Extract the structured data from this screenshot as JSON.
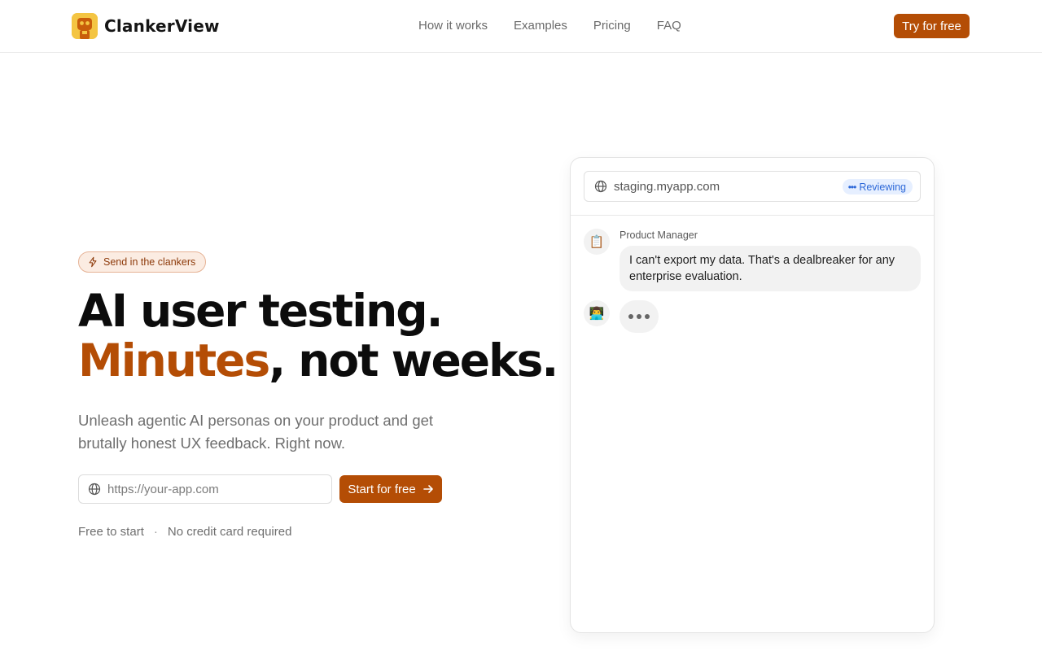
{
  "brand": {
    "name": "ClankerView",
    "accent_color": "#b44d05",
    "logo_color": "#f2c53d"
  },
  "nav": {
    "items": [
      {
        "label": "How it works"
      },
      {
        "label": "Examples"
      },
      {
        "label": "Pricing"
      },
      {
        "label": "FAQ"
      }
    ],
    "cta_label": "Try for free"
  },
  "hero": {
    "badge": {
      "icon": "lightning-icon",
      "text": "Send in the clankers"
    },
    "headline_line1": "AI user testing.",
    "headline_accent": "Minutes",
    "headline_line2_rest": ", not weeks.",
    "subhead": "Unleash agentic AI personas on your product and get brutally honest UX feedback. Right now.",
    "url_input": {
      "placeholder": "https://your-app.com",
      "value": "",
      "icon": "globe-icon"
    },
    "start_button_label": "Start for free",
    "footnote_left": "Free to start",
    "footnote_sep": "·",
    "footnote_right": "No credit card required"
  },
  "preview": {
    "address": "staging.myapp.com",
    "status": "Reviewing",
    "status_color": "#2d68d8",
    "messages": [
      {
        "avatar": "📋",
        "sender": "Product Manager",
        "text": "I can't export my data. That's a dealbreaker for any enterprise evaluation."
      },
      {
        "avatar": "👨‍💻",
        "typing": true
      }
    ]
  }
}
